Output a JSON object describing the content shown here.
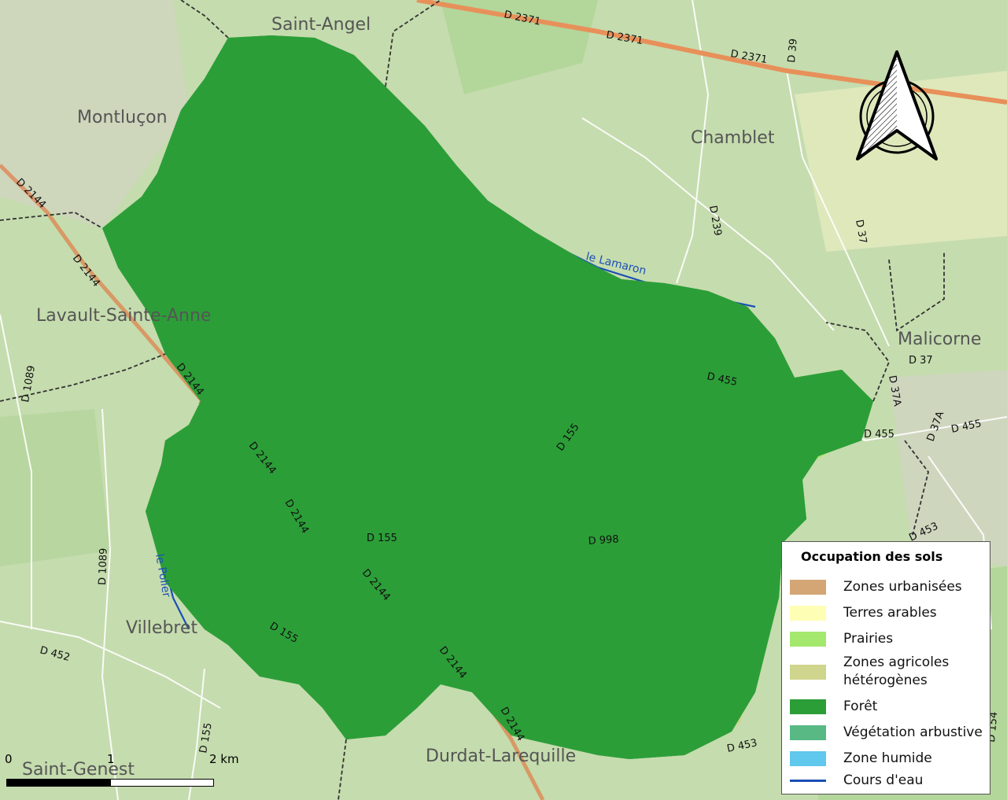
{
  "map": {
    "places": [
      "Saint-Angel",
      "Montluçon",
      "Chamblet",
      "Lavault-Sainte-Anne",
      "Malicorne",
      "Villebret",
      "Saint-Genest",
      "Durdat-Larequille"
    ],
    "roads": [
      "D 2371",
      "D 2371",
      "D 2371",
      "D 39",
      "D 239",
      "D 37",
      "D 37",
      "D 37A",
      "D 37A",
      "D 455",
      "D 455",
      "D 455",
      "D 453",
      "D 453",
      "D 2144",
      "D 2144",
      "D 2144",
      "D 2144",
      "D 2144",
      "D 2144",
      "D 2144",
      "D 2144",
      "D 155",
      "D 155",
      "D 155",
      "D 155",
      "D 998",
      "D 1089",
      "D 1089",
      "D 452",
      "D 154"
    ],
    "rivers": [
      "le Lamaron",
      "le Polier"
    ]
  },
  "legend": {
    "title": "Occupation des sols",
    "items": [
      {
        "label": "Zones urbanisées",
        "color": "#d4a676",
        "kind": "fill"
      },
      {
        "label": "Terres arables",
        "color": "#fefeb4",
        "kind": "fill"
      },
      {
        "label": "Prairies",
        "color": "#a5e86e",
        "kind": "fill"
      },
      {
        "label": "Zones agricoles hétérogènes",
        "color": "#cfd58c",
        "kind": "fill"
      },
      {
        "label": "Forêt",
        "color": "#2c9e38",
        "kind": "fill"
      },
      {
        "label": "Végétation arbustive",
        "color": "#58b985",
        "kind": "fill"
      },
      {
        "label": "Zone humide",
        "color": "#5fc8ec",
        "kind": "fill"
      },
      {
        "label": "Cours d'eau",
        "color": "#1a4fb5",
        "kind": "line"
      }
    ]
  },
  "scale": {
    "ticks": [
      "0",
      "1",
      "2 km"
    ]
  },
  "colors": {
    "background": "#c9dfb0",
    "forest": "#2c9e38",
    "meadow": "#a5e86e",
    "heterogeneous": "#cfd58c",
    "arable": "#fefeb4",
    "urban": "#d4a676",
    "river": "#1a4fb5",
    "main_road": "#e8632a",
    "boundary": "#333333"
  }
}
